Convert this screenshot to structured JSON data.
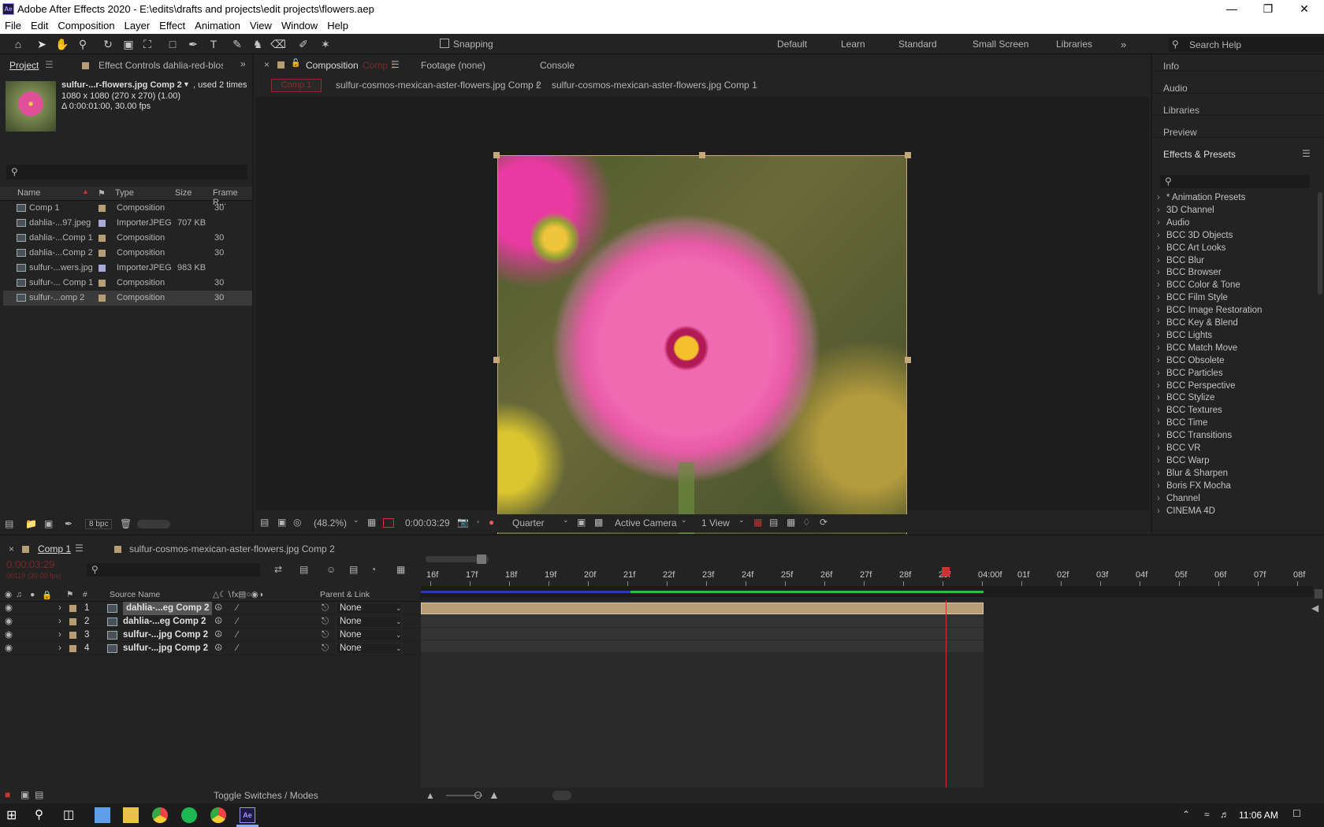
{
  "window": {
    "title": "Adobe After Effects 2020 - E:\\edits\\drafts and projects\\edit projects\\flowers.aep",
    "app_icon": "Ae"
  },
  "menu": [
    "File",
    "Edit",
    "Composition",
    "Layer",
    "Effect",
    "Animation",
    "View",
    "Window",
    "Help"
  ],
  "toolbar": {
    "snapping": "Snapping",
    "workspaces": [
      "Default",
      "Learn",
      "Standard",
      "Small Screen",
      "Libraries"
    ],
    "search_placeholder": "Search Help"
  },
  "project": {
    "tab": "Project",
    "effect_controls": "Effect Controls dahlia-red-blosso",
    "preview_name": "sulfur-...r-flowers.jpg Comp 2",
    "used": ", used 2 times",
    "dims": "1080 x 1080  (270 x 270) (1.00)",
    "duration": "Δ 0:00:01:00, 30.00 fps",
    "search_placeholder": "",
    "columns": {
      "name": "Name",
      "type": "Type",
      "size": "Size",
      "fr": "Frame R..."
    },
    "items": [
      {
        "name": "Comp 1",
        "type": "Composition",
        "size": "",
        "fr": "30",
        "label": "#b69d73",
        "kind": "comp"
      },
      {
        "name": "dahlia-...97.jpeg",
        "type": "ImporterJPEG",
        "size": "707 KB",
        "fr": "",
        "label": "#a9a9d9",
        "kind": "file"
      },
      {
        "name": "dahlia-...Comp 1",
        "type": "Composition",
        "size": "",
        "fr": "30",
        "label": "#b69d73",
        "kind": "comp"
      },
      {
        "name": "dahlia-...Comp 2",
        "type": "Composition",
        "size": "",
        "fr": "30",
        "label": "#b69d73",
        "kind": "comp"
      },
      {
        "name": "sulfur-...wers.jpg",
        "type": "ImporterJPEG",
        "size": "983 KB",
        "fr": "",
        "label": "#a9a9d9",
        "kind": "file"
      },
      {
        "name": "sulfur-... Comp 1",
        "type": "Composition",
        "size": "",
        "fr": "30",
        "label": "#b69d73",
        "kind": "comp"
      },
      {
        "name": "sulfur-...omp 2",
        "type": "Composition",
        "size": "",
        "fr": "30",
        "label": "#b69d73",
        "kind": "comp"
      }
    ],
    "bpc": "8 bpc"
  },
  "comp": {
    "tabs": [
      "Composition",
      "Footage (none)",
      "Console"
    ],
    "comp_tab_suffix": "Comp 1",
    "breadcrumb_active": "Comp 1",
    "breadcrumb": [
      "sulfur-cosmos-mexican-aster-flowers.jpg Comp 2",
      "sulfur-cosmos-mexican-aster-flowers.jpg Comp 1"
    ],
    "bottom": {
      "zoom": "(48.2%)",
      "timecode": "0:00:03:29",
      "resolution": "Quarter",
      "camera": "Active Camera",
      "views": "1 View"
    }
  },
  "right": {
    "panels": [
      "Info",
      "Audio",
      "Libraries",
      "Preview",
      "Effects & Presets"
    ],
    "effects": [
      "* Animation Presets",
      "3D Channel",
      "Audio",
      "BCC 3D Objects",
      "BCC Art Looks",
      "BCC Blur",
      "BCC Browser",
      "BCC Color & Tone",
      "BCC Film Style",
      "BCC Image Restoration",
      "BCC Key & Blend",
      "BCC Lights",
      "BCC Match Move",
      "BCC Obsolete",
      "BCC Particles",
      "BCC Perspective",
      "BCC Stylize",
      "BCC Textures",
      "BCC Time",
      "BCC Transitions",
      "BCC VR",
      "BCC Warp",
      "Blur & Sharpen",
      "Boris FX Mocha",
      "Channel",
      "CINEMA 4D"
    ]
  },
  "timeline": {
    "tabs": [
      "Comp 1",
      "sulfur-cosmos-mexican-aster-flowers.jpg Comp 2"
    ],
    "timecode": "0:00:03:29",
    "frames": "00119 (30.00 fps)",
    "columns": {
      "num": "#",
      "source": "Source Name",
      "parent": "Parent & Link"
    },
    "layers": [
      {
        "num": "1",
        "name": "dahlia-...eg Comp 2",
        "parent": "None"
      },
      {
        "num": "2",
        "name": "dahlia-...eg Comp 2",
        "parent": "None"
      },
      {
        "num": "3",
        "name": "sulfur-...jpg Comp 2",
        "parent": "None"
      },
      {
        "num": "4",
        "name": "sulfur-...jpg Comp 2",
        "parent": "None"
      }
    ],
    "ticks": [
      "16f",
      "17f",
      "18f",
      "19f",
      "20f",
      "21f",
      "22f",
      "23f",
      "24f",
      "25f",
      "26f",
      "27f",
      "28f",
      "29f",
      "04:00f",
      "01f",
      "02f",
      "03f",
      "04f",
      "05f",
      "06f",
      "07f",
      "08f"
    ],
    "toggle": "Toggle Switches / Modes"
  },
  "taskbar": {
    "time": "11:06 AM"
  }
}
